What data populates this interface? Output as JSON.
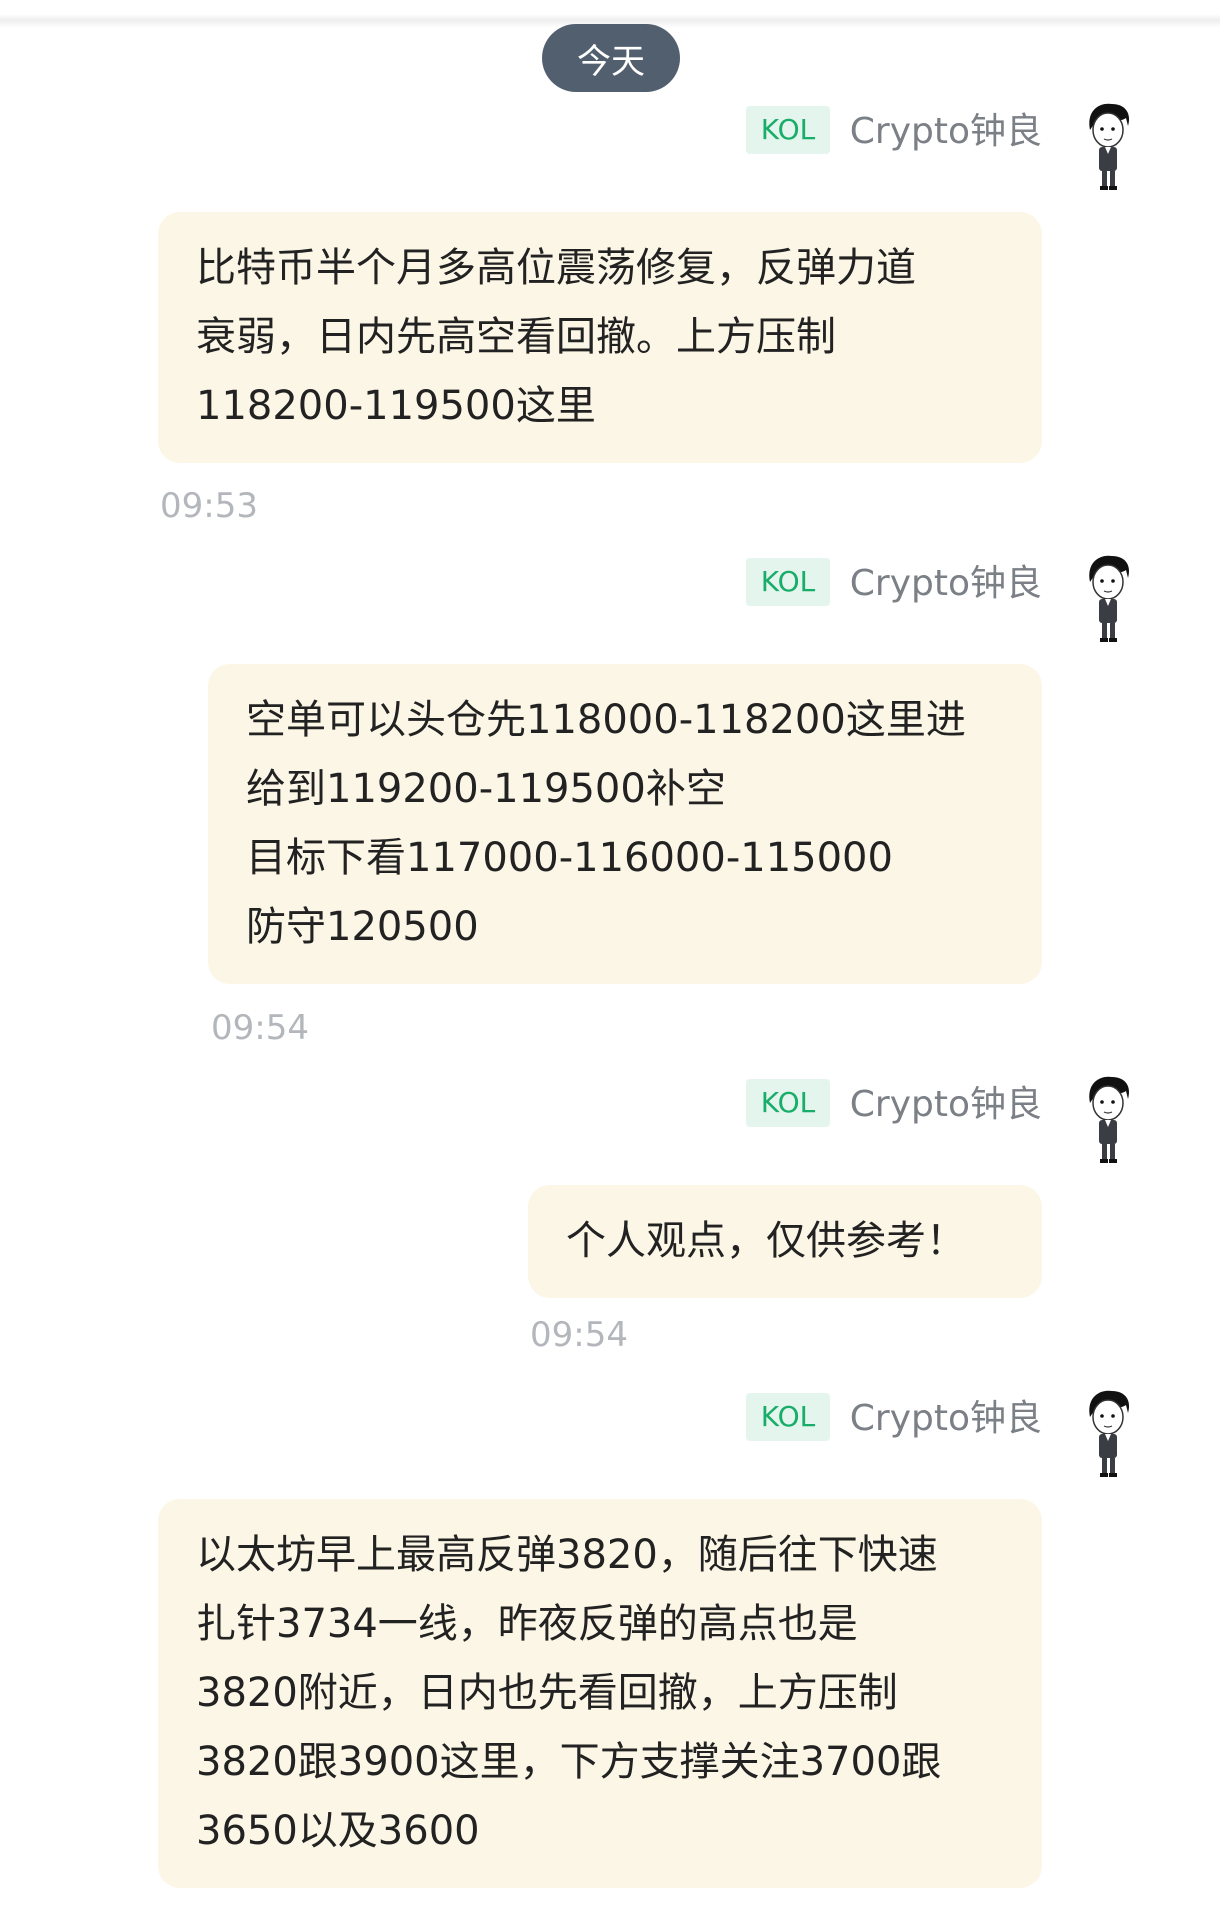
{
  "date_divider": "今天",
  "messages": [
    {
      "badge": "KOL",
      "sender": "Crypto钟良",
      "lines": [
        "比特币半个月多高位震荡修复，反弹力道",
        "衰弱，日内先高空看回撤。上方压制",
        "118200-119500这里"
      ],
      "time": "09:53"
    },
    {
      "badge": "KOL",
      "sender": "Crypto钟良",
      "lines": [
        "空单可以头仓先118000-118200这里进",
        "给到119200-119500补空",
        "目标下看117000-116000-115000",
        "防守120500"
      ],
      "time": "09:54"
    },
    {
      "badge": "KOL",
      "sender": "Crypto钟良",
      "lines": [
        "个人观点，仅供参考！"
      ],
      "time": "09:54"
    },
    {
      "badge": "KOL",
      "sender": "Crypto钟良",
      "lines": [
        "以太坊早上最高反弹3820，随后往下快速",
        "扎针3734一线，昨夜反弹的高点也是",
        "3820附近，日内也先看回撤，上方压制",
        "3820跟3900这里，下方支撑关注3700跟",
        "3650以及3600"
      ]
    }
  ],
  "colors": {
    "bubble": "#fcf6e6",
    "badge_bg": "#e3f5ec",
    "badge_text": "#19ad6a",
    "pill": "#525f6f"
  },
  "icons": {
    "avatar": "avatar-icon"
  }
}
